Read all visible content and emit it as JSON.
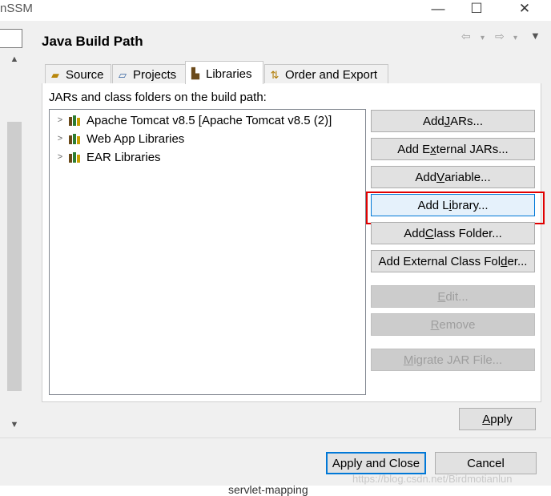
{
  "window": {
    "title": "nSSM",
    "minimize_glyph": "—",
    "maximize_glyph": "☐",
    "close_glyph": "✕"
  },
  "dialog": {
    "title": "Java Build Path",
    "nav": {
      "back_glyph": "⇦",
      "forward_glyph": "⇨",
      "dropdown_glyph": "▾",
      "menu_glyph": "▼"
    }
  },
  "tabs": [
    {
      "label": "Source",
      "icon": "source-folder-icon",
      "active": false
    },
    {
      "label": "Projects",
      "icon": "projects-icon",
      "active": false
    },
    {
      "label": "Libraries",
      "icon": "libraries-icon",
      "active": true
    },
    {
      "label": "Order and Export",
      "icon": "order-export-icon",
      "active": false
    }
  ],
  "libraries": {
    "heading": "JARs and class folders on the build path:",
    "items": [
      {
        "label": "Apache Tomcat v8.5 [Apache Tomcat v8.5 (2)]",
        "icon": "library-icon"
      },
      {
        "label": "Web App Libraries",
        "icon": "library-icon"
      },
      {
        "label": "EAR Libraries",
        "icon": "library-icon"
      }
    ]
  },
  "buttons": {
    "add_jars": {
      "pre": "Add ",
      "u": "J",
      "post": "ARs..."
    },
    "add_external_jars": {
      "pre": "Add E",
      "u": "x",
      "post": "ternal JARs..."
    },
    "add_variable": {
      "pre": "Add ",
      "u": "V",
      "post": "ariable..."
    },
    "add_library": {
      "pre": "Add L",
      "u": "i",
      "post": "brary..."
    },
    "add_class_folder": {
      "pre": "Add ",
      "u": "C",
      "post": "lass Folder..."
    },
    "add_external_class_folder": {
      "pre": "Add External Class Fol",
      "u": "d",
      "post": "er..."
    },
    "edit": {
      "pre": "",
      "u": "E",
      "post": "dit..."
    },
    "remove": {
      "pre": "",
      "u": "R",
      "post": "emove"
    },
    "migrate_jar": {
      "pre": "",
      "u": "M",
      "post": "igrate JAR File..."
    }
  },
  "footer": {
    "apply": {
      "pre": "",
      "u": "A",
      "post": "pply"
    },
    "apply_and_close": "Apply and Close",
    "cancel": "Cancel"
  },
  "background": {
    "editor_line": "servlet-mapping",
    "watermark": "https://blog.csdn.net/Birdmotianlun"
  },
  "colors": {
    "highlight_box": "#e00000",
    "default_button_border": "#0078d7",
    "dialog_bg": "#f0f0f0"
  }
}
